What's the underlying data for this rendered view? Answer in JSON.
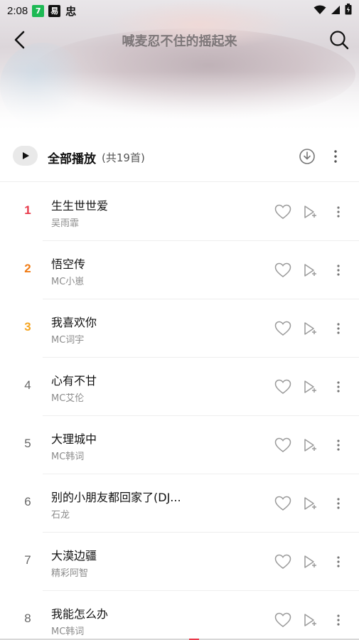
{
  "status_bar": {
    "time": "2:08",
    "icon1": "7",
    "icon2": "易",
    "icon3": "忠",
    "right_icons": [
      "wifi-icon",
      "signal-icon",
      "battery-icon"
    ]
  },
  "header": {
    "title": "喊麦忍不住的摇起来",
    "back_icon": "back-arrow-icon",
    "search_icon": "search-icon"
  },
  "play_all": {
    "label": "全部播放",
    "count": "(共19首)",
    "download_icon": "download-icon",
    "more_icon": "more-vertical-icon"
  },
  "songs": [
    {
      "rank": "1",
      "title": "生生世世爱",
      "artist": "吴雨霏"
    },
    {
      "rank": "2",
      "title": "悟空传",
      "artist": "MC小崽"
    },
    {
      "rank": "3",
      "title": "我喜欢你",
      "artist": "MC词宇"
    },
    {
      "rank": "4",
      "title": "心有不甘",
      "artist": "MC艾伦"
    },
    {
      "rank": "5",
      "title": "大理城中",
      "artist": "MC韩词"
    },
    {
      "rank": "6",
      "title": "别的小朋友都回家了(DJ...",
      "artist": "石龙"
    },
    {
      "rank": "7",
      "title": "大漠边疆",
      "artist": "精彩阿智"
    },
    {
      "rank": "8",
      "title": "我能怎么办",
      "artist": "MC韩词"
    }
  ],
  "colors": {
    "rank1": "#e8394a",
    "rank2": "#f07c16",
    "rank3": "#f5a623",
    "title_muted": "#7d7779",
    "divider": "#eeeeee"
  }
}
